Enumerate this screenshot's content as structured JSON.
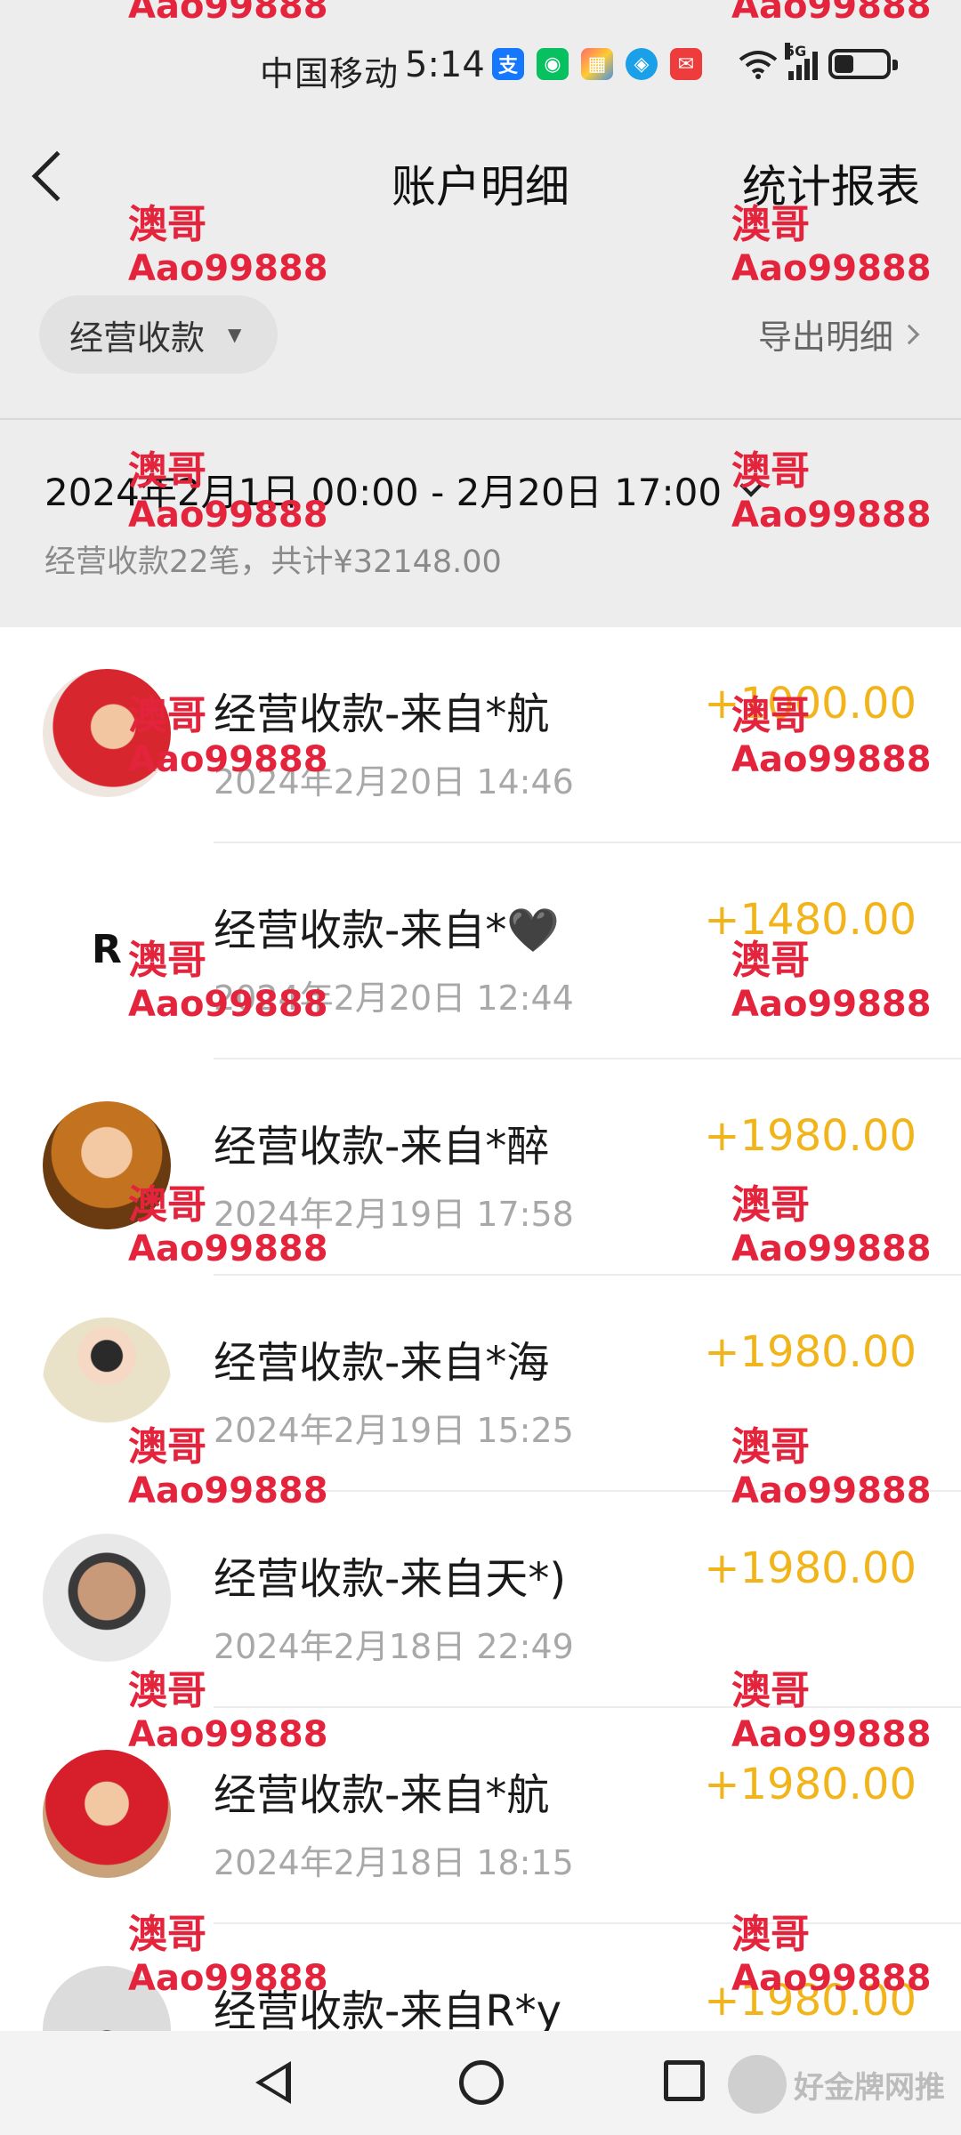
{
  "status_bar": {
    "carrier": "中国移动",
    "time": "5:14",
    "network": "5G"
  },
  "nav": {
    "title": "账户明细",
    "action": "统计报表"
  },
  "filter": {
    "selected": "经营收款",
    "export_label": "导出明细"
  },
  "range": {
    "label": "2024年2月1日 00:00 - 2月20日 17:00",
    "summary": "经营收款22笔，共计¥32148.00"
  },
  "transactions": [
    {
      "title": "经营收款-来自*航",
      "date": "2024年2月20日 14:46",
      "amount": "+1000.00"
    },
    {
      "title": "经营收款-来自*🖤",
      "date": "2024年2月20日 12:44",
      "amount": "+1480.00"
    },
    {
      "title": "经营收款-来自*醉",
      "date": "2024年2月19日 17:58",
      "amount": "+1980.00"
    },
    {
      "title": "经营收款-来自*海",
      "date": "2024年2月19日 15:25",
      "amount": "+1980.00"
    },
    {
      "title": "经营收款-来自天*)",
      "date": "2024年2月18日 22:49",
      "amount": "+1980.00"
    },
    {
      "title": "经营收款-来自*航",
      "date": "2024年2月18日 18:15",
      "amount": "+1980.00"
    },
    {
      "title": "经营收款-来自R*y",
      "date": "",
      "amount": "+1980.00"
    }
  ],
  "watermark": {
    "name": "澳哥",
    "id": "Aao99888"
  },
  "corner_watermark": "好金牌网推",
  "colors": {
    "amount": "#f1b41a",
    "watermark": "#e3243c",
    "header_bg": "#ededed"
  }
}
